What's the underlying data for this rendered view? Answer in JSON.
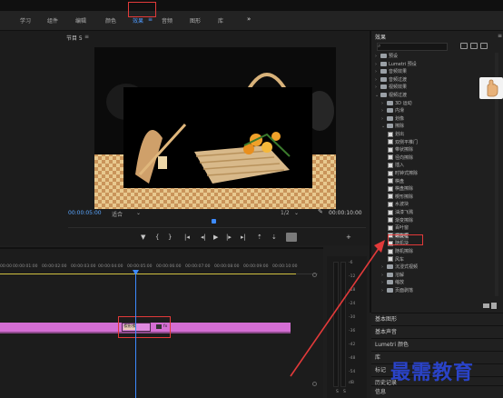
{
  "workspace_tabs": [
    "学习",
    "组件",
    "编辑",
    "颜色",
    "效果",
    "音频",
    "图形",
    "库"
  ],
  "workspace_active": "效果",
  "workspace_more": "»",
  "program": {
    "title": "节目 5",
    "menu": "≡",
    "timecode_left": "00:00:05:00",
    "fit": "适合",
    "ratio": "1/2",
    "timecode_right": "00:00:10:00"
  },
  "transport_icons": [
    "marker-icon",
    "in-point-icon",
    "out-point-icon",
    "go-in-icon",
    "step-back-icon",
    "play-icon",
    "step-forward-icon",
    "go-out-icon",
    "lift-icon",
    "extract-icon",
    "camera-icon",
    "export-icon"
  ],
  "timeline": {
    "ticks": [
      "00:00",
      "00:00:01:00",
      "00:00:02:00",
      "00:00:03:00",
      "00:00:04:00",
      "00:00:05:00",
      "00:00:06:00",
      "00:00:07:00",
      "00:00:08:00",
      "00:00:09:00",
      "00:00:10:00"
    ],
    "transition_label": "楔形擦",
    "clip_label": "fx"
  },
  "meters": {
    "db_scale": [
      "-6",
      "-12",
      "-18",
      "-24",
      "-30",
      "-36",
      "-42",
      "-48",
      "-54",
      "dB"
    ],
    "channels": [
      "S",
      "S"
    ]
  },
  "effects_panel": {
    "title": "效果",
    "menu": "≡",
    "rows": [
      {
        "label": "预设",
        "indent": 0,
        "kind": "folder",
        "arrow": "›"
      },
      {
        "label": "Lumetri 预设",
        "indent": 0,
        "kind": "folder",
        "arrow": "›"
      },
      {
        "label": "音频效果",
        "indent": 0,
        "kind": "folder",
        "arrow": "›"
      },
      {
        "label": "音频过渡",
        "indent": 0,
        "kind": "folder",
        "arrow": "›"
      },
      {
        "label": "视频效果",
        "indent": 0,
        "kind": "folder",
        "arrow": "›"
      },
      {
        "label": "视频过渡",
        "indent": 0,
        "kind": "folder",
        "arrow": "⌄"
      },
      {
        "label": "3D 运动",
        "indent": 1,
        "kind": "folder",
        "arrow": "›"
      },
      {
        "label": "内滑",
        "indent": 1,
        "kind": "folder",
        "arrow": "›"
      },
      {
        "label": "划像",
        "indent": 1,
        "kind": "folder",
        "arrow": "›"
      },
      {
        "label": "擦除",
        "indent": 1,
        "kind": "folder",
        "arrow": "⌄"
      },
      {
        "label": "划出",
        "indent": 2,
        "kind": "fx"
      },
      {
        "label": "双侧平推门",
        "indent": 2,
        "kind": "fx"
      },
      {
        "label": "带状擦除",
        "indent": 2,
        "kind": "fx"
      },
      {
        "label": "径向擦除",
        "indent": 2,
        "kind": "fx"
      },
      {
        "label": "插入",
        "indent": 2,
        "kind": "fx"
      },
      {
        "label": "时钟式擦除",
        "indent": 2,
        "kind": "fx"
      },
      {
        "label": "棋盘",
        "indent": 2,
        "kind": "fx"
      },
      {
        "label": "棋盘擦除",
        "indent": 2,
        "kind": "fx"
      },
      {
        "label": "楔形擦除",
        "indent": 2,
        "kind": "fx"
      },
      {
        "label": "水波块",
        "indent": 2,
        "kind": "fx"
      },
      {
        "label": "油漆飞溅",
        "indent": 2,
        "kind": "fx"
      },
      {
        "label": "渐变擦除",
        "indent": 2,
        "kind": "fx"
      },
      {
        "label": "百叶窗",
        "indent": 2,
        "kind": "fx"
      },
      {
        "label": "螺旋框",
        "indent": 2,
        "kind": "fx",
        "selected": true
      },
      {
        "label": "随机块",
        "indent": 2,
        "kind": "fx"
      },
      {
        "label": "随机擦除",
        "indent": 2,
        "kind": "fx"
      },
      {
        "label": "风车",
        "indent": 2,
        "kind": "fx"
      },
      {
        "label": "沉浸式视频",
        "indent": 1,
        "kind": "folder",
        "arrow": "›"
      },
      {
        "label": "溶解",
        "indent": 1,
        "kind": "folder",
        "arrow": "›"
      },
      {
        "label": "缩放",
        "indent": 1,
        "kind": "folder",
        "arrow": "›"
      },
      {
        "label": "页面剥落",
        "indent": 1,
        "kind": "folder",
        "arrow": "›"
      }
    ]
  },
  "lower_panels": [
    "基本图形",
    "基本声音",
    "Lumetri 颜色",
    "库",
    "标记",
    "历史记录",
    "信息"
  ],
  "watermark": "最需教育",
  "colors": {
    "accent_blue": "#3d8bff",
    "highlight_red": "#e23a3a",
    "clip_pink": "#d46ed3",
    "watermark_blue": "#2a43c8"
  }
}
